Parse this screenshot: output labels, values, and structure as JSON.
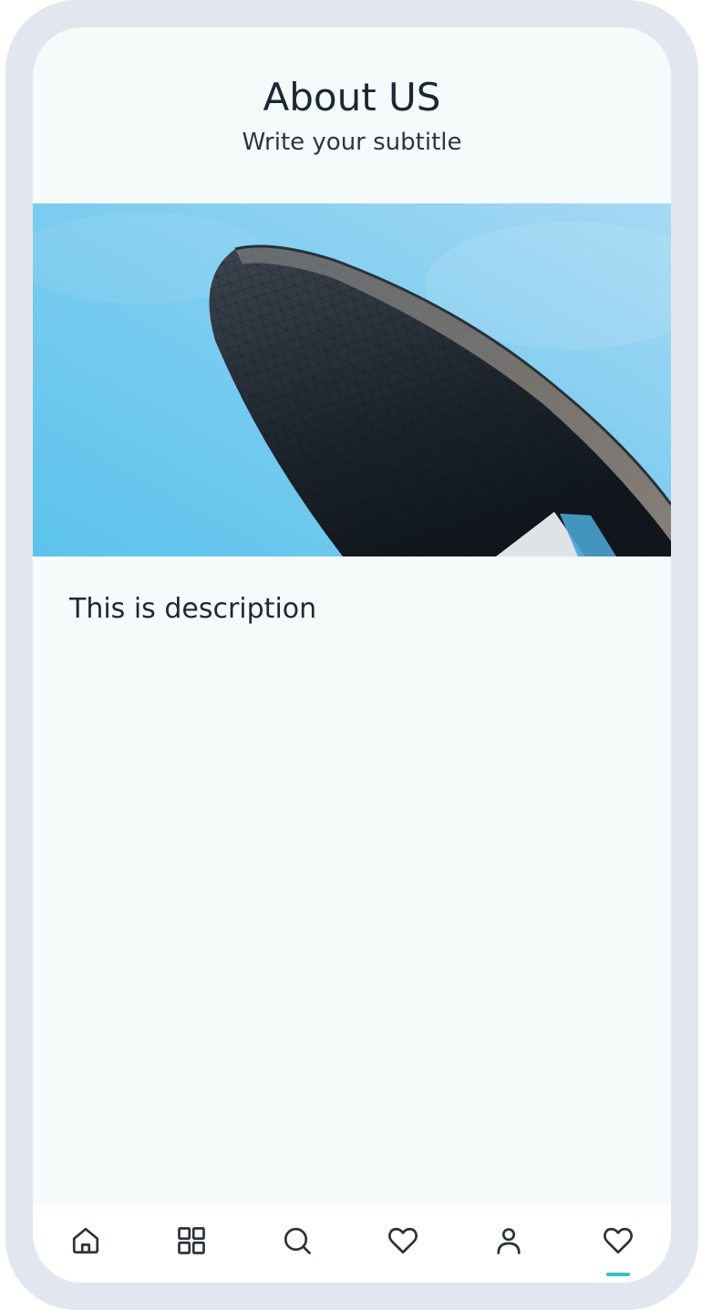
{
  "header": {
    "title": "About US",
    "subtitle": "Write your subtitle"
  },
  "main": {
    "description": "This is description"
  },
  "bottom_nav": {
    "items": [
      {
        "icon": "home-icon"
      },
      {
        "icon": "grid-icon"
      },
      {
        "icon": "search-icon"
      },
      {
        "icon": "heart-icon"
      },
      {
        "icon": "user-icon"
      },
      {
        "icon": "heart-icon",
        "active": true
      }
    ],
    "accent_color": "#2ec4c3"
  }
}
